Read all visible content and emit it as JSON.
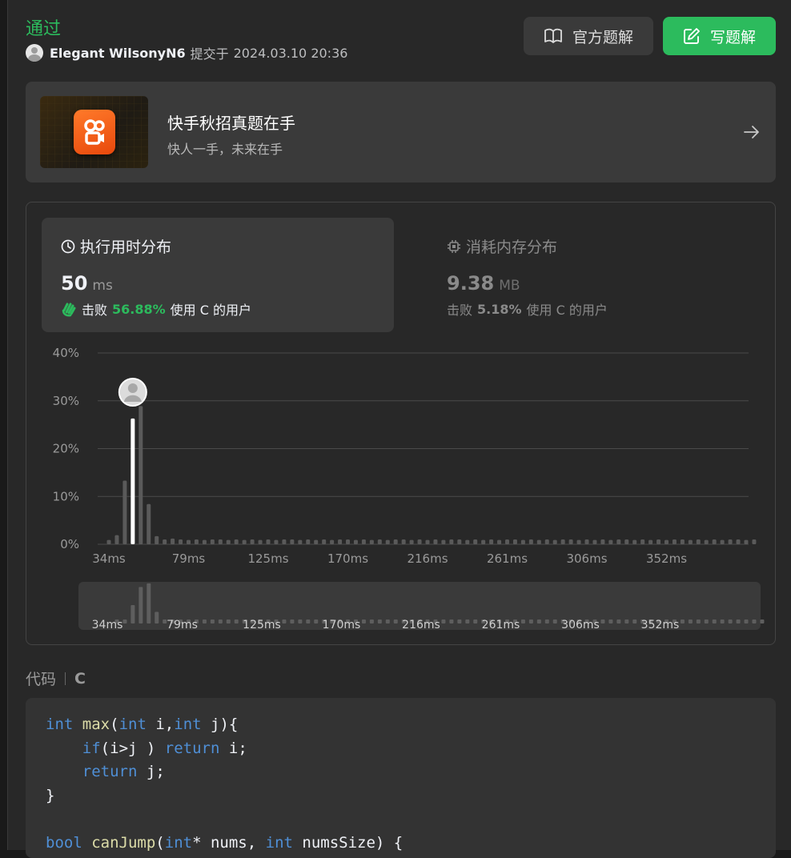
{
  "header": {
    "status": "通过",
    "username": "Elegant WilsonyN6",
    "submitted_label": "提交于",
    "submitted_at": "2024.03.10 20:36",
    "official_solution_button": "官方题解",
    "write_solution_button": "写题解"
  },
  "banner": {
    "title": "快手秋招真题在手",
    "subtitle": "快人一手，未来在手"
  },
  "runtime": {
    "label": "执行用时分布",
    "value": "50",
    "unit": "ms",
    "beat_prefix": "击败",
    "beat_percent": "56.88%",
    "beat_suffix": "使用 C 的用户"
  },
  "memory": {
    "label": "消耗内存分布",
    "value": "9.38",
    "unit": "MB",
    "beat_prefix": "击败",
    "beat_percent": "5.18%",
    "beat_suffix": "使用 C 的用户"
  },
  "chart_data": {
    "type": "bar",
    "title": "",
    "xlabel": "",
    "ylabel": "",
    "ylim": [
      0,
      40
    ],
    "yticks": [
      "0%",
      "10%",
      "20%",
      "30%",
      "40%"
    ],
    "xticks": [
      "34ms",
      "79ms",
      "125ms",
      "170ms",
      "216ms",
      "261ms",
      "306ms",
      "352ms"
    ],
    "grid": true,
    "highlight": {
      "label": "50ms",
      "value": 26.3
    },
    "values": [
      0.9,
      1.9,
      13.3,
      26.3,
      28.9,
      8.4,
      1.7,
      1.0,
      1.2,
      1.0,
      0.9,
      1.0,
      0.9,
      1.0,
      1.0,
      0.9,
      1.0,
      0.9,
      1.0,
      0.9,
      1.0,
      0.9,
      1.0,
      1.0,
      0.9,
      1.0,
      0.9,
      1.0,
      0.9,
      1.0,
      1.0,
      0.9,
      1.0,
      0.9,
      1.0,
      0.9,
      1.0,
      1.0,
      0.9,
      1.0,
      0.9,
      1.0,
      0.9,
      1.0,
      1.0,
      0.9,
      1.0,
      0.9,
      1.0,
      0.9,
      1.0,
      1.0,
      0.9,
      1.0,
      0.9,
      1.0,
      0.9,
      1.0,
      1.0,
      0.9,
      1.0,
      0.9,
      1.0,
      0.9,
      1.0,
      1.0,
      0.9,
      1.0,
      0.9,
      1.0,
      0.9,
      1.0,
      1.0,
      0.9,
      1.0,
      0.9,
      1.0,
      0.9,
      1.0,
      1.0,
      0.9,
      1.0
    ]
  },
  "code": {
    "label": "代码",
    "language": "C",
    "lines": [
      {
        "t": "int max(int i,int j){"
      },
      {
        "t": "    if(i>j ) return i;"
      },
      {
        "t": "    return j;"
      },
      {
        "t": "}"
      },
      {
        "t": ""
      },
      {
        "t": "bool canJump(int* nums, int numsSize) {"
      }
    ]
  },
  "colors": {
    "accent_green": "#2cbb5d",
    "bar_gray": "#5a5a5a",
    "highlight_bar": "#ffffff",
    "keyword_blue": "#4f8fd6",
    "function_yellow": "#dcdca8"
  }
}
